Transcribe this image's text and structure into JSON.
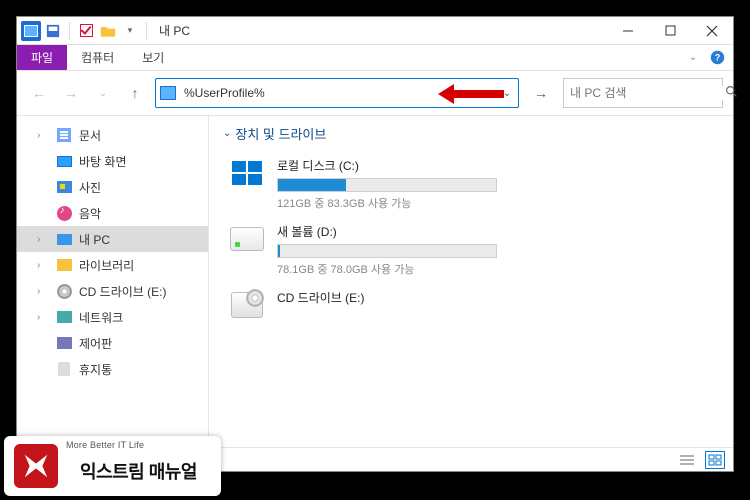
{
  "title": "내 PC",
  "menu": {
    "file": "파일",
    "computer": "컴퓨터",
    "view": "보기"
  },
  "address": {
    "value": "%UserProfile%"
  },
  "search": {
    "placeholder": "내 PC 검색"
  },
  "sidebar": [
    {
      "label": "문서",
      "icon": "docs",
      "expandable": true,
      "selected": false
    },
    {
      "label": "바탕 화면",
      "icon": "desk",
      "expandable": false,
      "selected": false
    },
    {
      "label": "사진",
      "icon": "pic",
      "expandable": false,
      "selected": false
    },
    {
      "label": "음악",
      "icon": "music",
      "expandable": false,
      "selected": false
    },
    {
      "label": "내 PC",
      "icon": "pc",
      "expandable": true,
      "selected": true
    },
    {
      "label": "라이브러리",
      "icon": "lib",
      "expandable": true,
      "selected": false
    },
    {
      "label": "CD 드라이브 (E:)",
      "icon": "cd",
      "expandable": true,
      "selected": false
    },
    {
      "label": "네트워크",
      "icon": "net",
      "expandable": true,
      "selected": false
    },
    {
      "label": "제어판",
      "icon": "ctrl",
      "expandable": false,
      "selected": false
    },
    {
      "label": "휴지통",
      "icon": "trash",
      "expandable": false,
      "selected": false
    }
  ],
  "section": {
    "header": "장치 및 드라이브"
  },
  "drives": [
    {
      "title": "로컬 디스크 (C:)",
      "sub": "121GB 중 83.3GB 사용 가능",
      "usedPct": 31,
      "icon": "win"
    },
    {
      "title": "새 볼륨 (D:)",
      "sub": "78.1GB 중 78.0GB 사용 가능",
      "usedPct": 1,
      "icon": "hdd"
    },
    {
      "title": "CD 드라이브 (E:)",
      "sub": "",
      "usedPct": null,
      "icon": "cd"
    }
  ],
  "logo": {
    "tagline": "More Better IT Life",
    "name": "익스트림 매뉴얼"
  }
}
